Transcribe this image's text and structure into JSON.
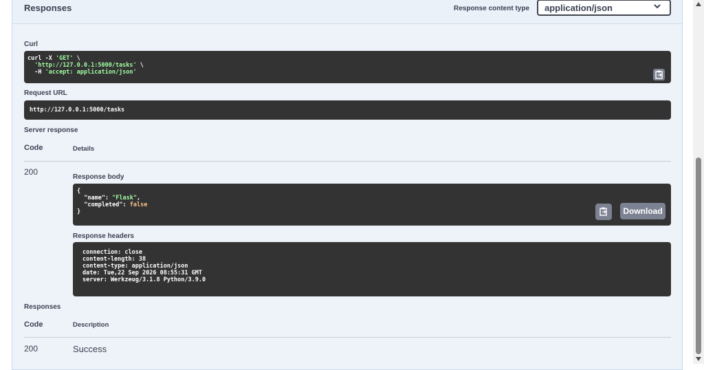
{
  "header": {
    "title": "Responses",
    "content_type_label": "Response content type",
    "content_type_value": "application/json"
  },
  "curl": {
    "label": "Curl",
    "lines": [
      {
        "plain": "curl -X ",
        "str": "'GET'",
        "tail": " \\"
      },
      {
        "plain": "  ",
        "str": "'http://127.0.0.1:5000/tasks'",
        "tail": " \\"
      },
      {
        "plain": "  -H ",
        "str": "'accept: application/json'",
        "tail": ""
      }
    ]
  },
  "request_url": {
    "label": "Request URL",
    "value": "http://127.0.0.1:5000/tasks"
  },
  "server_response": {
    "label": "Server response",
    "col_code": "Code",
    "col_details": "Details",
    "status_code": "200",
    "body_label": "Response body",
    "body": {
      "open": "{",
      "name_key": "  \"name\": ",
      "name_val": "\"Flask\"",
      "name_tail": ",",
      "completed_key": "  \"completed\": ",
      "completed_val": "false",
      "close": "}"
    },
    "download_label": "Download",
    "headers_label": "Response headers",
    "headers": [
      "connection: close",
      "content-length: 38",
      "content-type: application/json",
      "date: Tue,22 Sep 2026 08:55:31 GMT",
      "server: Werkzeug/3.1.8 Python/3.9.0"
    ]
  },
  "responses": {
    "label": "Responses",
    "col_code": "Code",
    "col_description": "Description",
    "rows": [
      {
        "code": "200",
        "description": "Success"
      }
    ]
  }
}
